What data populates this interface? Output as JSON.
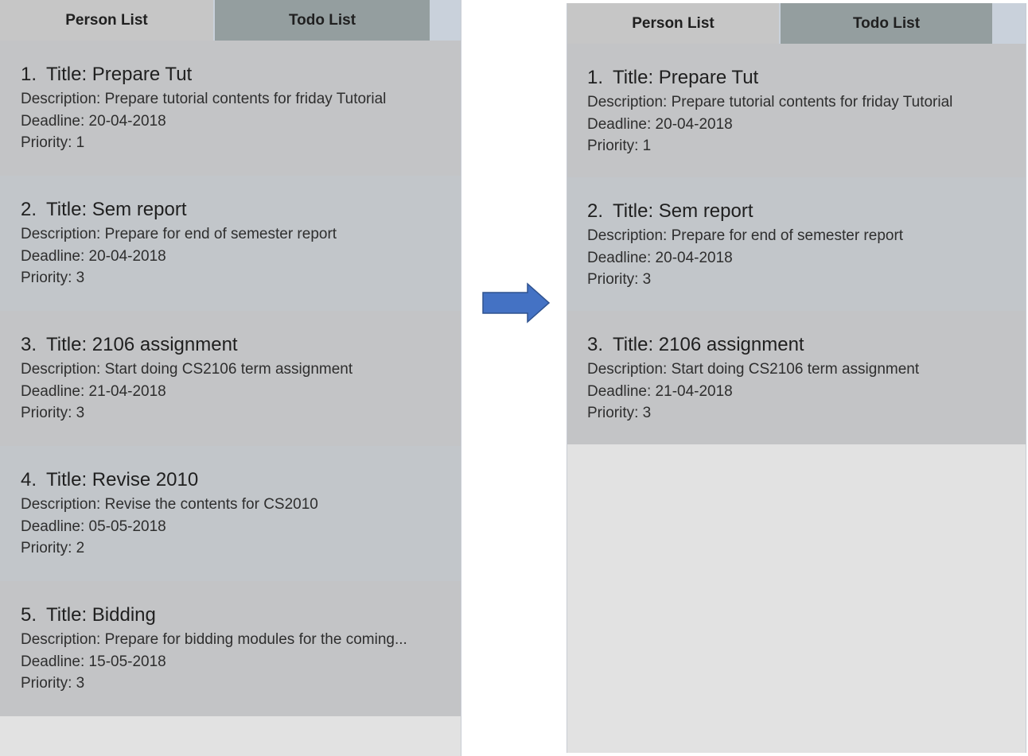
{
  "tabs": {
    "person_label": "Person List",
    "todo_label": "Todo List"
  },
  "before": {
    "items": [
      {
        "index": "1.",
        "title": "Title: Prepare Tut",
        "description": "Description: Prepare tutorial contents for friday Tutorial",
        "deadline": "Deadline: 20-04-2018",
        "priority": "Priority: 1"
      },
      {
        "index": "2.",
        "title": "Title: Sem report",
        "description": "Description: Prepare for end of semester report",
        "deadline": "Deadline: 20-04-2018",
        "priority": "Priority: 3"
      },
      {
        "index": "3.",
        "title": "Title: 2106 assignment",
        "description": "Description: Start doing CS2106 term assignment",
        "deadline": "Deadline: 21-04-2018",
        "priority": "Priority: 3"
      },
      {
        "index": "4.",
        "title": "Title: Revise 2010",
        "description": "Description: Revise the contents for CS2010",
        "deadline": "Deadline: 05-05-2018",
        "priority": "Priority: 2"
      },
      {
        "index": "5.",
        "title": "Title: Bidding",
        "description": "Description: Prepare for bidding modules for the coming...",
        "deadline": "Deadline: 15-05-2018",
        "priority": "Priority: 3"
      }
    ]
  },
  "after": {
    "items": [
      {
        "index": "1.",
        "title": "Title: Prepare Tut",
        "description": "Description: Prepare tutorial contents for friday Tutorial",
        "deadline": "Deadline: 20-04-2018",
        "priority": "Priority: 1"
      },
      {
        "index": "2.",
        "title": "Title: Sem report",
        "description": "Description: Prepare for end of semester report",
        "deadline": "Deadline: 20-04-2018",
        "priority": "Priority: 3"
      },
      {
        "index": "3.",
        "title": "Title: 2106 assignment",
        "description": "Description: Start doing CS2106 term assignment",
        "deadline": "Deadline: 21-04-2018",
        "priority": "Priority: 3"
      }
    ]
  },
  "colors": {
    "arrow": "#4472c4",
    "selected_tab": "#c6c6c6",
    "unselected_tab": "#949e9f"
  },
  "icons": {
    "transition": "right-arrow-icon"
  }
}
